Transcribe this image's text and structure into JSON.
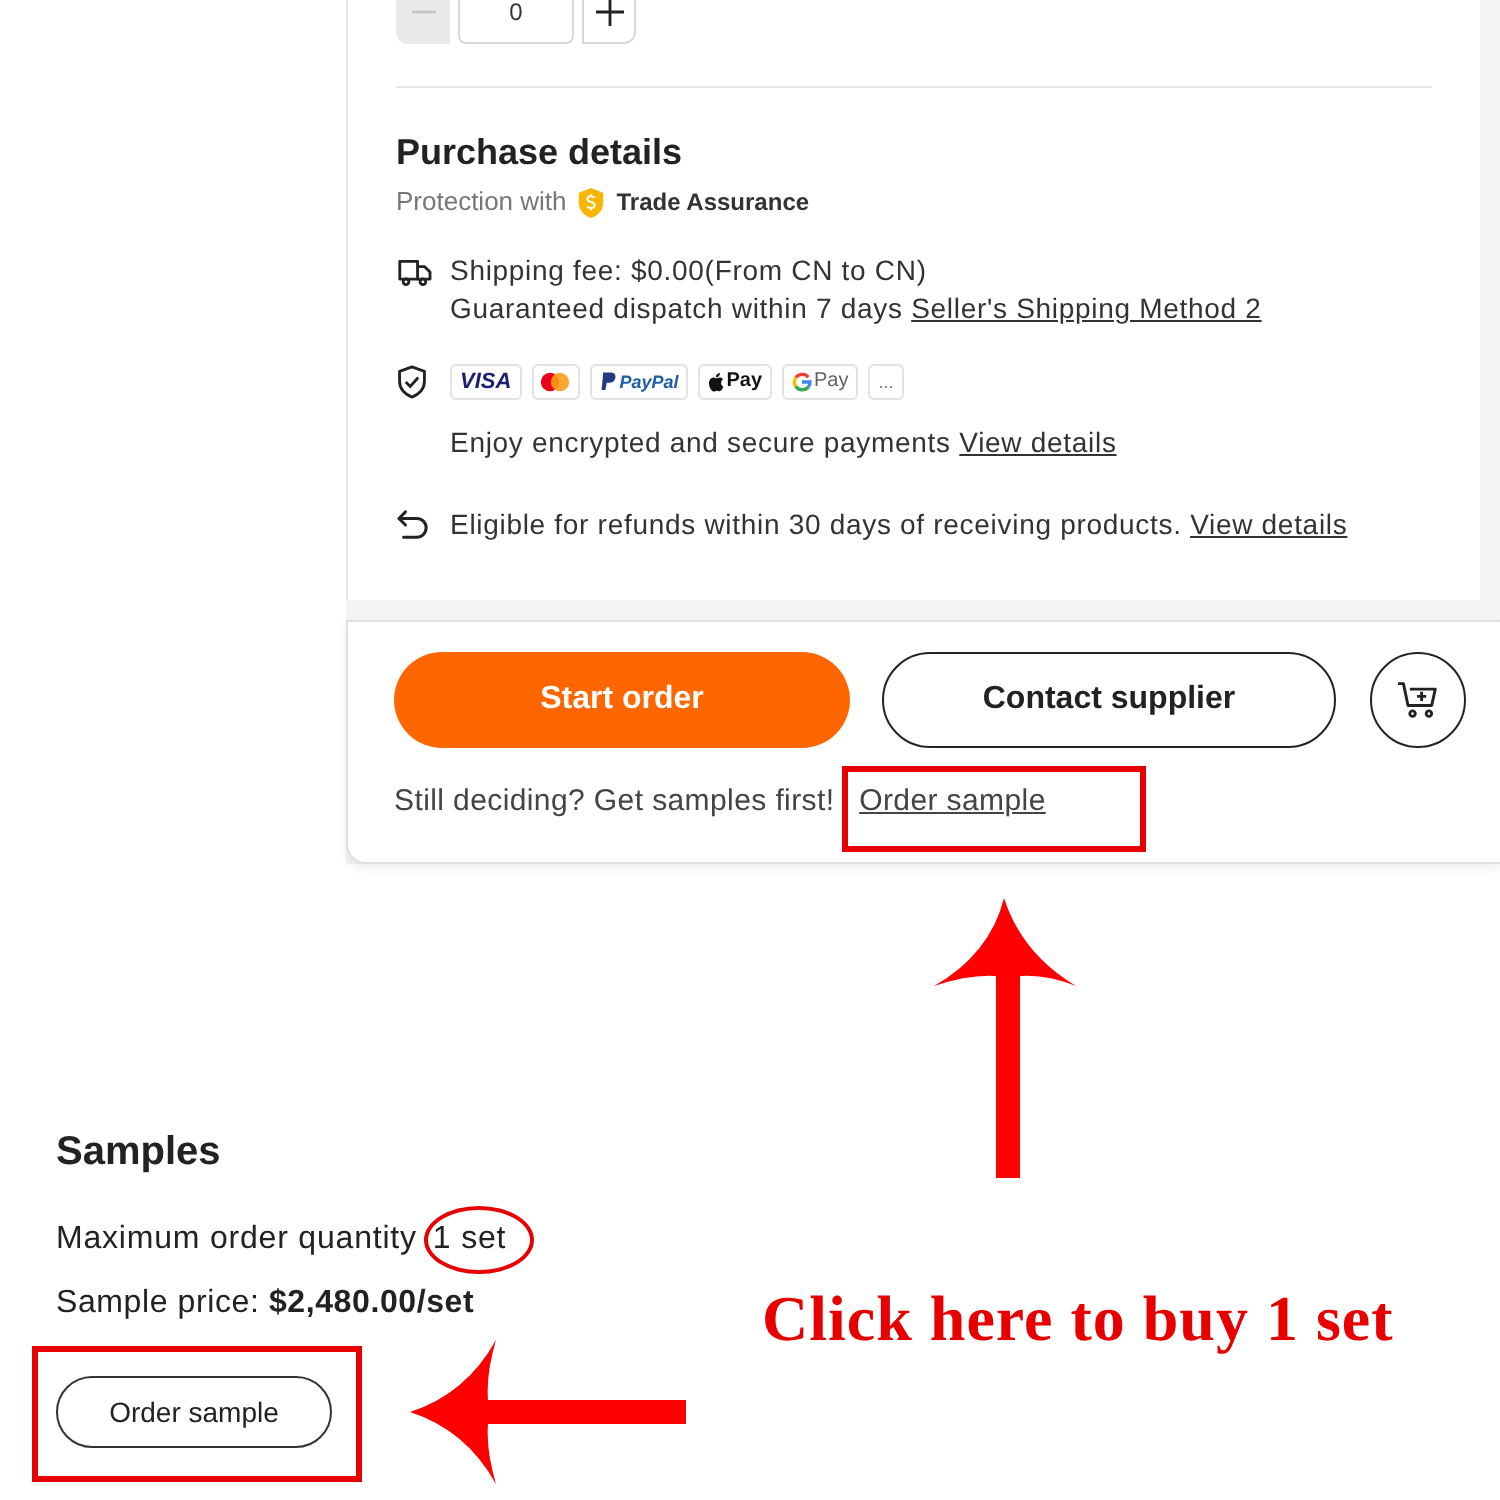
{
  "quantity": {
    "value": "0",
    "decrease_disabled": true
  },
  "purchase_details": {
    "title": "Purchase details",
    "protection_label": "Protection with",
    "protection_badge": "Trade Assurance",
    "shipping": {
      "fee": "Shipping fee: $0.00(From CN to CN)",
      "dispatch": "Guaranteed dispatch within 7 days",
      "method_link": "Seller's Shipping Method 2"
    },
    "payment": {
      "methods": [
        {
          "kind": "visa",
          "label": "VISA"
        },
        {
          "kind": "mastercard"
        },
        {
          "kind": "paypal",
          "label": "PayPal"
        },
        {
          "kind": "applepay",
          "label": "Pay"
        },
        {
          "kind": "googlepay",
          "label": "Pay"
        },
        {
          "kind": "more",
          "label": "..."
        }
      ],
      "note": "Enjoy encrypted and secure payments",
      "link": "View details"
    },
    "refund": {
      "text": "Eligible for refunds within 30 days of receiving products.",
      "link": "View details"
    }
  },
  "actions": {
    "buttons": [
      {
        "kind": "primary",
        "label": "Start order"
      },
      {
        "kind": "outline",
        "label": "Contact supplier"
      },
      {
        "kind": "cart"
      }
    ],
    "prompt": "Still deciding? Get samples first!",
    "prompt_link": "Order sample"
  },
  "samples": {
    "title": "Samples",
    "max_quantity_label": "Maximum order quantity",
    "max_quantity_value": "1 set",
    "price": "Sample price: **$2,480.00/set**",
    "button": "Order sample"
  },
  "annotation": {
    "caption": "Click here to buy 1 set"
  }
}
